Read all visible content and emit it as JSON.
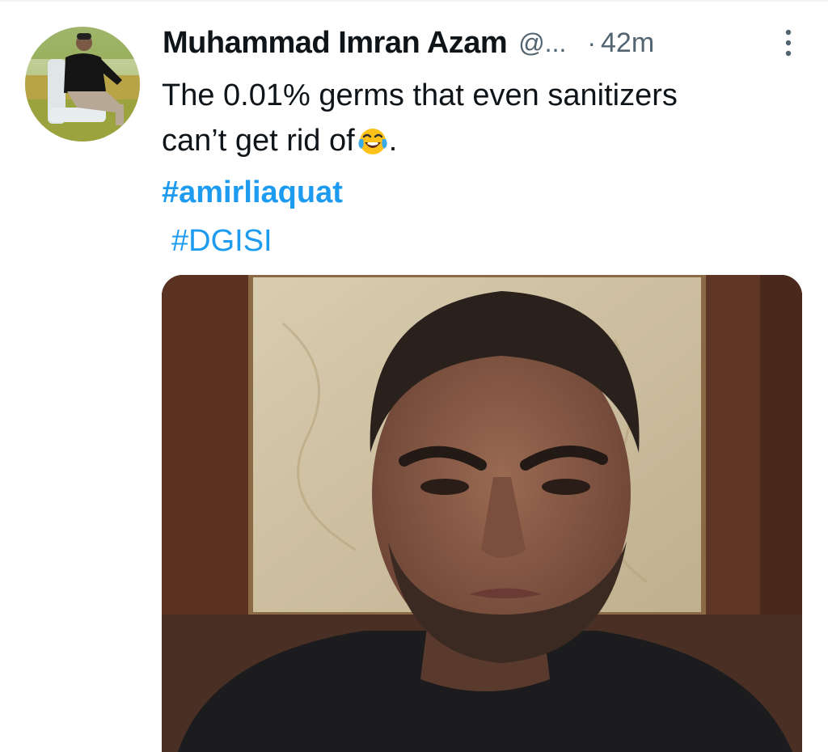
{
  "tweet": {
    "author": {
      "display_name": "Muhammad Imran Azam",
      "handle": "@..."
    },
    "separator": "·",
    "timestamp": "42m",
    "text_line_1": "The 0.01% germs that even sanitizers",
    "text_line_2": "can’t get rid of",
    "text_end": ".",
    "emoji": "face-with-tears-of-joy",
    "hashtags": [
      "#amirliaquat",
      "#DGISI"
    ]
  },
  "colors": {
    "accent": "#1d9bf0",
    "text_primary": "#0f1419",
    "text_secondary": "#536471"
  },
  "icons": {
    "more": "more-vertical-icon"
  }
}
